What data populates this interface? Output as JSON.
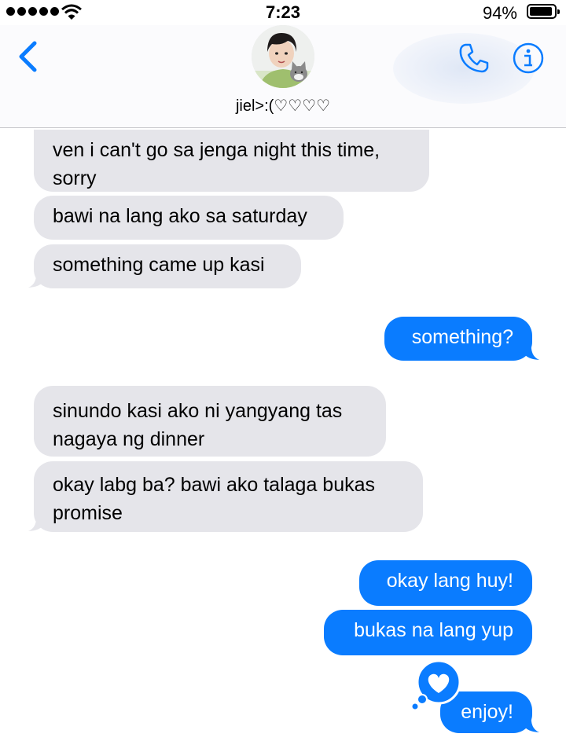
{
  "status_bar": {
    "time": "7:23",
    "battery_percent_text": "94%",
    "battery_level": 0.94,
    "signal_bars": 5,
    "signal_icon": "signal-dots-icon",
    "wifi_icon": "wifi-icon"
  },
  "header": {
    "contact_name": "jiel>:(♡♡♡♡",
    "back_icon": "chevron-left-icon",
    "call_icon": "phone-icon",
    "info_icon": "info-icon",
    "accent_color": "#0a7cff"
  },
  "messages": [
    {
      "direction": "incoming",
      "text_lines": [
        "ven i can't go sa jenga night this time,",
        "sorry"
      ]
    },
    {
      "direction": "incoming",
      "text_lines": [
        "bawi na lang ako sa saturday"
      ]
    },
    {
      "direction": "incoming",
      "text_lines": [
        "something came up kasi"
      ]
    },
    {
      "direction": "outgoing",
      "text_lines": [
        "something?"
      ]
    },
    {
      "direction": "incoming",
      "text_lines": [
        "sinundo kasi ako ni yangyang tas",
        "nagaya ng dinner"
      ]
    },
    {
      "direction": "incoming",
      "text_lines": [
        "okay labg ba? bawi ako talaga bukas",
        "promise"
      ]
    },
    {
      "direction": "outgoing",
      "text_lines": [
        "okay lang huy!"
      ]
    },
    {
      "direction": "outgoing",
      "text_lines": [
        "bukas na lang yup"
      ]
    },
    {
      "direction": "outgoing",
      "text_lines": [
        "enjoy!"
      ],
      "tapback": "heart-icon"
    }
  ],
  "colors": {
    "incoming_bubble": "#e5e5ea",
    "outgoing_bubble": "#0a7cff"
  }
}
